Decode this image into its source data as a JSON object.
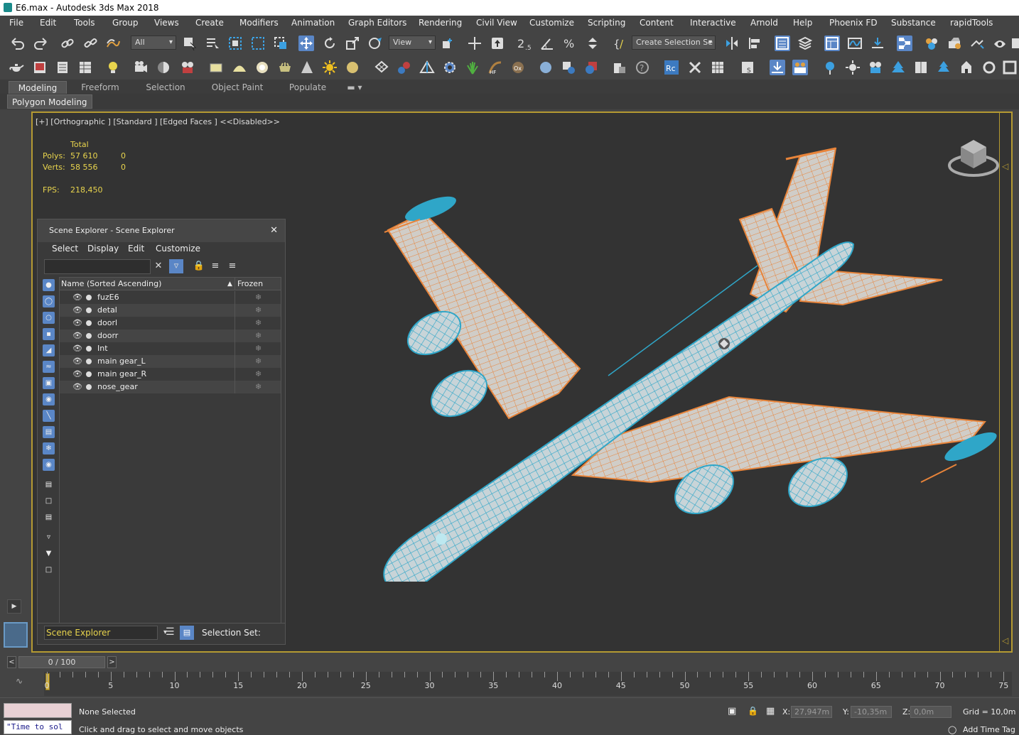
{
  "window": {
    "title": "E6.max - Autodesk 3ds Max 2018"
  },
  "menu": [
    "File",
    "Edit",
    "Tools",
    "Group",
    "Views",
    "Create",
    "Modifiers",
    "Animation",
    "Graph Editors",
    "Rendering",
    "Civil View",
    "Customize",
    "Scripting",
    "Content",
    "Interactive",
    "Arnold",
    "Help",
    "Phoenix FD",
    "Substance",
    "rapidTools"
  ],
  "toolbar": {
    "selection_filter": "All",
    "ref_coord": "View",
    "create_selection_set": "Create Selection Se",
    "snap_label": "2.5"
  },
  "ribbon": {
    "tabs": [
      "Modeling",
      "Freeform",
      "Selection",
      "Object Paint",
      "Populate"
    ],
    "active_tab": "Modeling",
    "panel": "Polygon Modeling"
  },
  "viewport": {
    "label": "[+] [Orthographic ] [Standard ] [Edged Faces ]  <<Disabled>>",
    "stats": {
      "total_label": "Total",
      "polys_label": "Polys:",
      "polys_total": "57 610",
      "polys_sel": "0",
      "verts_label": "Verts:",
      "verts_total": "58 556",
      "verts_sel": "0",
      "fps_label": "FPS:",
      "fps_value": "218,450"
    }
  },
  "scene_explorer": {
    "title": "Scene Explorer - Scene Explorer",
    "menu": [
      "Select",
      "Display",
      "Edit",
      "Customize"
    ],
    "columns": {
      "name": "Name (Sorted Ascending)",
      "frozen": "Frozen"
    },
    "objects": [
      "fuzE6",
      "detal",
      "doorl",
      "doorr",
      "Int",
      "main gear_L",
      "main gear_R",
      "nose_gear"
    ],
    "dropdown": "Scene Explorer",
    "selection_set_label": "Selection Set:"
  },
  "timeline": {
    "slider": "0 / 100",
    "labels": [
      "0",
      "5",
      "10",
      "15",
      "20",
      "25",
      "30",
      "35",
      "40",
      "45",
      "50",
      "55",
      "60",
      "65",
      "70",
      "75"
    ]
  },
  "status": {
    "maxscript_text": "\"Time to sol",
    "selection": "None Selected",
    "prompt": "Click and drag to select and move objects",
    "x_label": "X:",
    "x_value": "27,947m",
    "y_label": "Y:",
    "y_value": "-10,35m",
    "z_label": "Z:",
    "z_value": "0,0m",
    "grid": "Grid = 10,0m",
    "add_time_tag": "Add Time Tag"
  },
  "colors": {
    "wire_fuselage": "#2fa6c8",
    "wire_wing": "#e8843a",
    "viewport_border": "#b59a32",
    "stats_text": "#e8d44d"
  }
}
